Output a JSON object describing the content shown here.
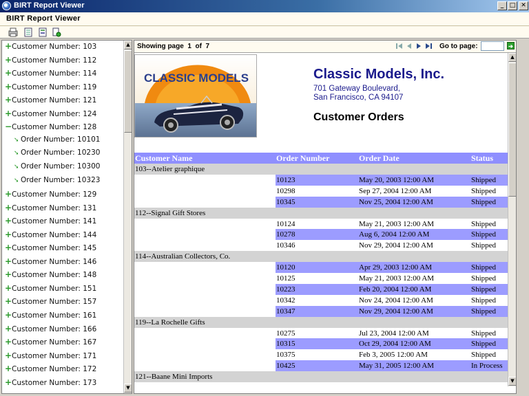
{
  "window": {
    "title": "BIRT Report Viewer",
    "minimize": "_",
    "maximize": "□",
    "close": "✕"
  },
  "app": {
    "title": "BIRT Report Viewer"
  },
  "toolbar": {
    "buttons": [
      {
        "icon": "toc-icon"
      },
      {
        "icon": "export-icon"
      },
      {
        "icon": "export-report-icon"
      },
      {
        "icon": "print-icon"
      }
    ]
  },
  "tree": {
    "items": [
      {
        "label": "Customer Number: 103",
        "level": 0,
        "expanded": false
      },
      {
        "label": "Customer Number: 112",
        "level": 0,
        "expanded": false
      },
      {
        "label": "Customer Number: 114",
        "level": 0,
        "expanded": false
      },
      {
        "label": "Customer Number: 119",
        "level": 0,
        "expanded": false
      },
      {
        "label": "Customer Number: 121",
        "level": 0,
        "expanded": false
      },
      {
        "label": "Customer Number: 124",
        "level": 0,
        "expanded": false
      },
      {
        "label": "Customer Number: 128",
        "level": 0,
        "expanded": true
      },
      {
        "label": "Order Number: 10101",
        "level": 1
      },
      {
        "label": "Order Number: 10230",
        "level": 1
      },
      {
        "label": "Order Number: 10300",
        "level": 1
      },
      {
        "label": "Order Number: 10323",
        "level": 1
      },
      {
        "label": "Customer Number: 129",
        "level": 0,
        "expanded": false
      },
      {
        "label": "Customer Number: 131",
        "level": 0,
        "expanded": false
      },
      {
        "label": "Customer Number: 141",
        "level": 0,
        "expanded": false
      },
      {
        "label": "Customer Number: 144",
        "level": 0,
        "expanded": false
      },
      {
        "label": "Customer Number: 145",
        "level": 0,
        "expanded": false
      },
      {
        "label": "Customer Number: 146",
        "level": 0,
        "expanded": false
      },
      {
        "label": "Customer Number: 148",
        "level": 0,
        "expanded": false
      },
      {
        "label": "Customer Number: 151",
        "level": 0,
        "expanded": false
      },
      {
        "label": "Customer Number: 157",
        "level": 0,
        "expanded": false
      },
      {
        "label": "Customer Number: 161",
        "level": 0,
        "expanded": false
      },
      {
        "label": "Customer Number: 166",
        "level": 0,
        "expanded": false
      },
      {
        "label": "Customer Number: 167",
        "level": 0,
        "expanded": false
      },
      {
        "label": "Customer Number: 171",
        "level": 0,
        "expanded": false
      },
      {
        "label": "Customer Number: 172",
        "level": 0,
        "expanded": false
      },
      {
        "label": "Customer Number: 173",
        "level": 0,
        "expanded": false
      }
    ],
    "expand_symbol": "+",
    "collapse_symbol": "−"
  },
  "nav": {
    "page_label": "Showing page",
    "current_page": "1",
    "of_label": "of",
    "total_pages": "7",
    "goto_label": "Go to page:",
    "goto_value": ""
  },
  "report": {
    "logo_text": "CLASSIC MODELS",
    "company": "Classic Models, Inc.",
    "address_line1": "701 Gateway Boulevard,",
    "address_line2": "San Francisco, CA 94107",
    "title": "Customer Orders",
    "columns": [
      "Customer Name",
      "Order Number",
      "Order Date",
      "Status"
    ],
    "groups": [
      {
        "name": "103--Atelier graphique",
        "orders": [
          {
            "number": "10123",
            "date": "May 20, 2003 12:00 AM",
            "status": "Shipped",
            "highlight": true
          },
          {
            "number": "10298",
            "date": "Sep 27, 2004 12:00 AM",
            "status": "Shipped",
            "highlight": false
          },
          {
            "number": "10345",
            "date": "Nov 25, 2004 12:00 AM",
            "status": "Shipped",
            "highlight": true
          }
        ]
      },
      {
        "name": "112--Signal Gift Stores",
        "orders": [
          {
            "number": "10124",
            "date": "May 21, 2003 12:00 AM",
            "status": "Shipped",
            "highlight": false
          },
          {
            "number": "10278",
            "date": "Aug 6, 2004 12:00 AM",
            "status": "Shipped",
            "highlight": true
          },
          {
            "number": "10346",
            "date": "Nov 29, 2004 12:00 AM",
            "status": "Shipped",
            "highlight": false
          }
        ]
      },
      {
        "name": "114--Australian Collectors, Co.",
        "orders": [
          {
            "number": "10120",
            "date": "Apr 29, 2003 12:00 AM",
            "status": "Shipped",
            "highlight": true
          },
          {
            "number": "10125",
            "date": "May 21, 2003 12:00 AM",
            "status": "Shipped",
            "highlight": false
          },
          {
            "number": "10223",
            "date": "Feb 20, 2004 12:00 AM",
            "status": "Shipped",
            "highlight": true
          },
          {
            "number": "10342",
            "date": "Nov 24, 2004 12:00 AM",
            "status": "Shipped",
            "highlight": false
          },
          {
            "number": "10347",
            "date": "Nov 29, 2004 12:00 AM",
            "status": "Shipped",
            "highlight": true
          }
        ]
      },
      {
        "name": "119--La Rochelle Gifts",
        "orders": [
          {
            "number": "10275",
            "date": "Jul 23, 2004 12:00 AM",
            "status": "Shipped",
            "highlight": false
          },
          {
            "number": "10315",
            "date": "Oct 29, 2004 12:00 AM",
            "status": "Shipped",
            "highlight": true
          },
          {
            "number": "10375",
            "date": "Feb 3, 2005 12:00 AM",
            "status": "Shipped",
            "highlight": false
          },
          {
            "number": "10425",
            "date": "May 31, 2005 12:00 AM",
            "status": "In Process",
            "highlight": true
          }
        ]
      },
      {
        "name": "121--Baane Mini Imports",
        "orders": []
      }
    ]
  },
  "colors": {
    "header_band": "#8f8fff",
    "highlight_row": "#9c9cff",
    "group_row": "#d3d3d3",
    "company_text": "#1a1a8c",
    "tree_plus": "#2a9a2a"
  }
}
